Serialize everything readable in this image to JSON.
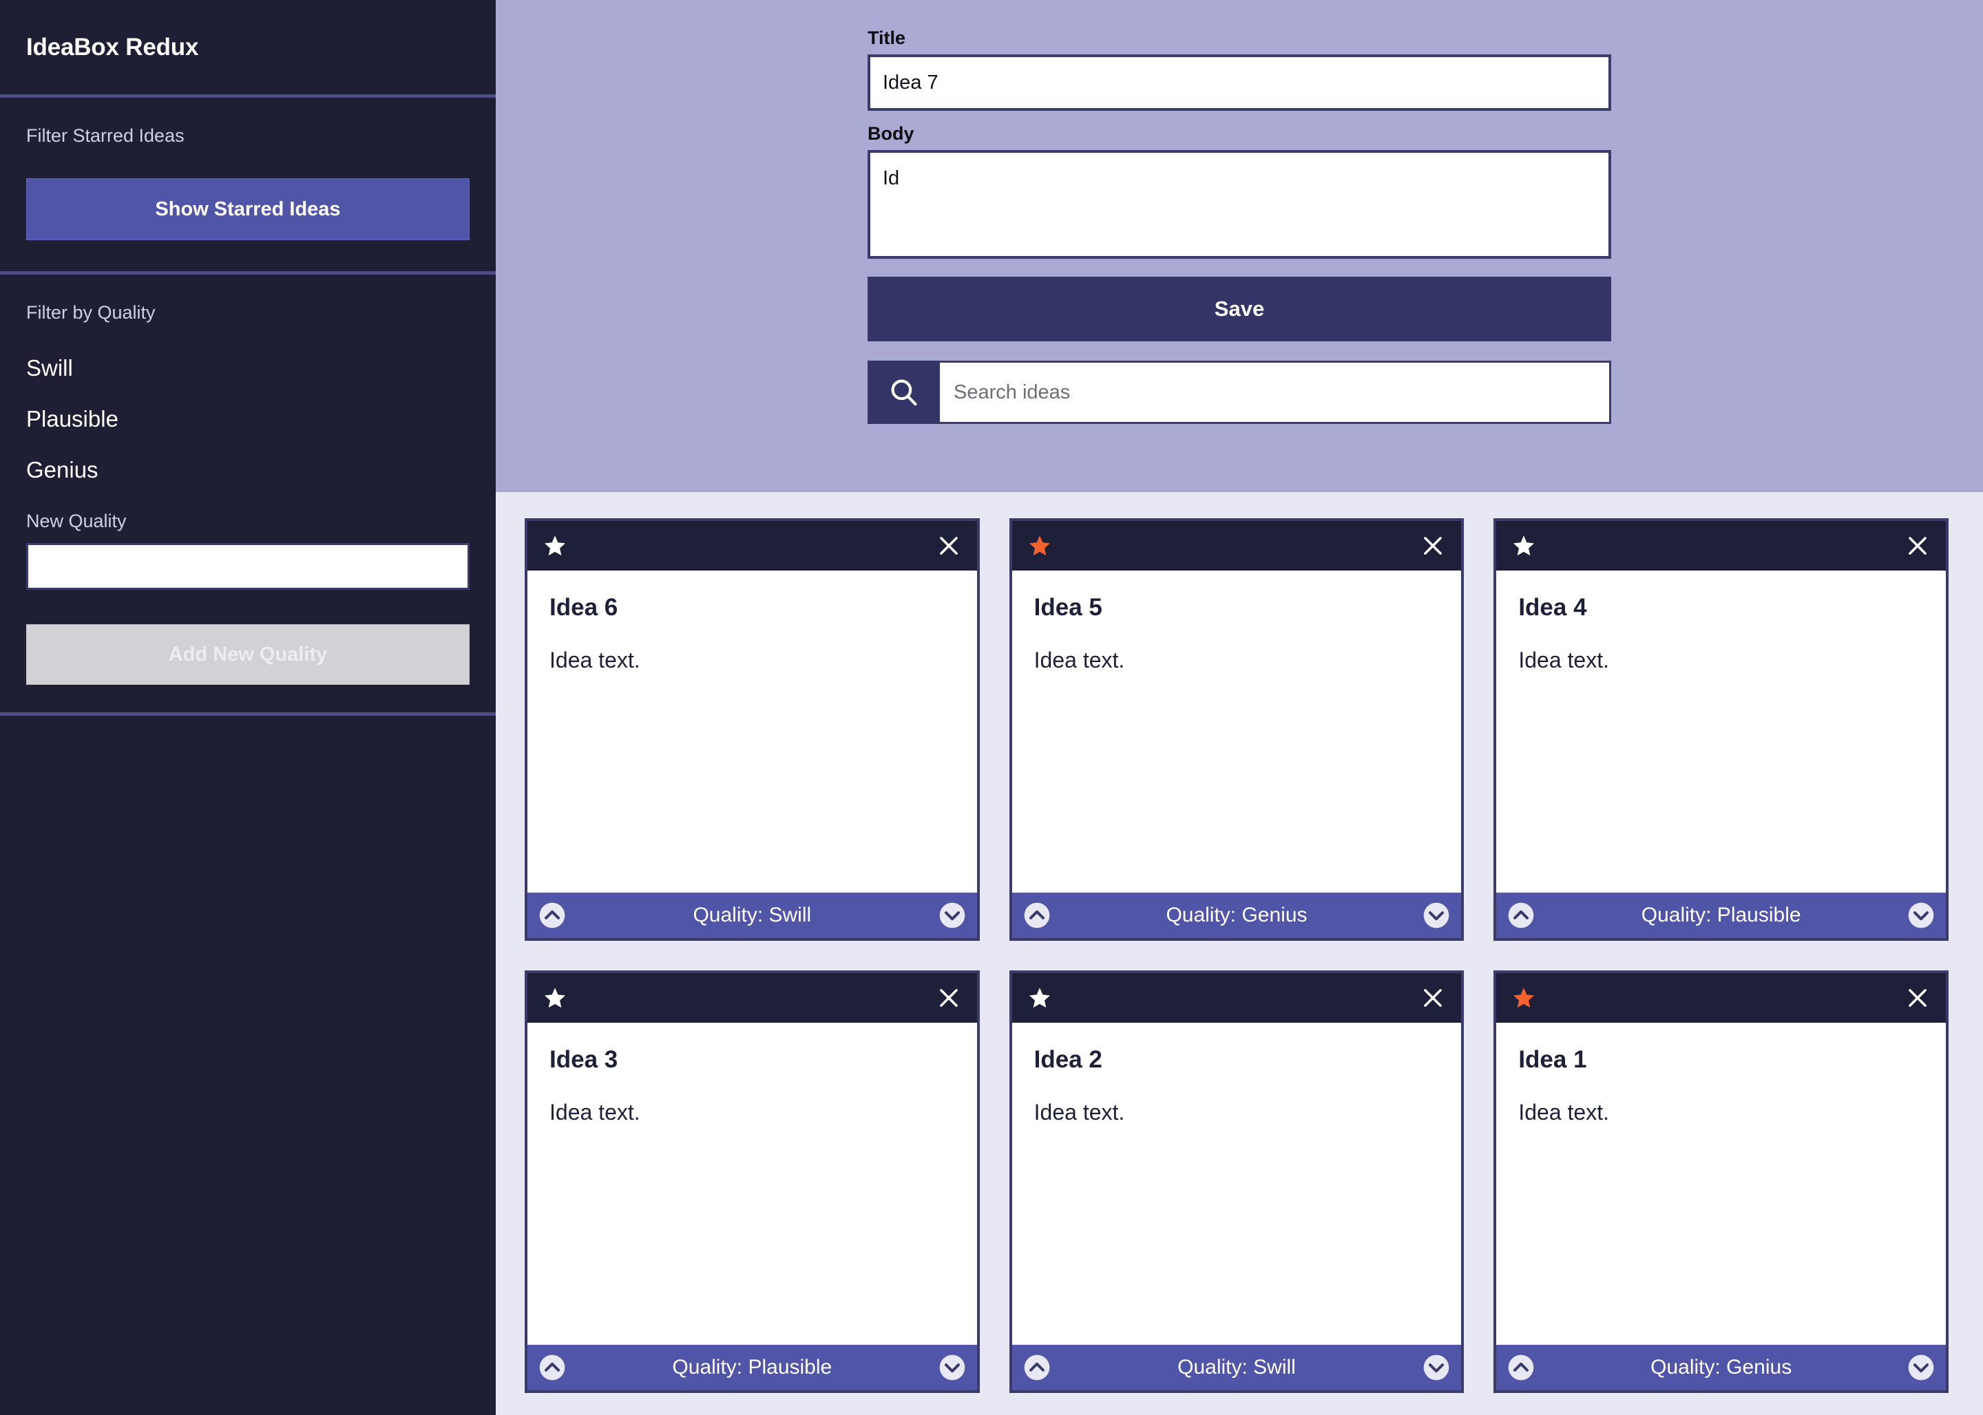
{
  "app": {
    "title": "IdeaBox Redux",
    "colors": {
      "sidebar_bg": "#1e1f35",
      "divider": "#4b4e87",
      "accent_purple": "#5055a8",
      "deep_navy": "#343466",
      "header_bg": "#aaaad4",
      "content_bg": "#e8e8f4",
      "card_header_bg": "#1e2039",
      "star_active": "#f4622e",
      "star_inactive": "#ffffff"
    }
  },
  "sidebar": {
    "starred_section": {
      "label": "Filter Starred Ideas",
      "button_label": "Show Starred Ideas"
    },
    "quality_section": {
      "label": "Filter by Quality",
      "items": [
        {
          "label": "Swill"
        },
        {
          "label": "Plausible"
        },
        {
          "label": "Genius"
        }
      ],
      "new_quality_label": "New Quality",
      "new_quality_value": "",
      "new_quality_placeholder": "",
      "add_button_label": "Add New Quality"
    }
  },
  "form": {
    "title_label": "Title",
    "title_value": "Idea 7",
    "title_placeholder": "",
    "body_label": "Body",
    "body_value": "Id",
    "body_placeholder": "",
    "save_label": "Save",
    "search_placeholder": "Search ideas",
    "search_value": "",
    "search_icon": "search-icon"
  },
  "ideas": [
    {
      "title": "Idea 6",
      "text": "Idea text.",
      "quality_label": "Quality: Swill",
      "starred": false,
      "star_icon": "star-icon",
      "close_icon": "close-icon",
      "up_icon": "chevron-up-circle-icon",
      "down_icon": "chevron-down-circle-icon"
    },
    {
      "title": "Idea 5",
      "text": "Idea text.",
      "quality_label": "Quality: Genius",
      "starred": true,
      "star_icon": "star-icon",
      "close_icon": "close-icon",
      "up_icon": "chevron-up-circle-icon",
      "down_icon": "chevron-down-circle-icon"
    },
    {
      "title": "Idea 4",
      "text": "Idea text.",
      "quality_label": "Quality: Plausible",
      "starred": false,
      "star_icon": "star-icon",
      "close_icon": "close-icon",
      "up_icon": "chevron-up-circle-icon",
      "down_icon": "chevron-down-circle-icon"
    },
    {
      "title": "Idea 3",
      "text": "Idea text.",
      "quality_label": "Quality: Plausible",
      "starred": false,
      "star_icon": "star-icon",
      "close_icon": "close-icon",
      "up_icon": "chevron-up-circle-icon",
      "down_icon": "chevron-down-circle-icon"
    },
    {
      "title": "Idea 2",
      "text": "Idea text.",
      "quality_label": "Quality: Swill",
      "starred": false,
      "star_icon": "star-icon",
      "close_icon": "close-icon",
      "up_icon": "chevron-up-circle-icon",
      "down_icon": "chevron-down-circle-icon"
    },
    {
      "title": "Idea 1",
      "text": "Idea text.",
      "quality_label": "Quality: Genius",
      "starred": true,
      "star_icon": "star-icon",
      "close_icon": "close-icon",
      "up_icon": "chevron-up-circle-icon",
      "down_icon": "chevron-down-circle-icon"
    }
  ]
}
